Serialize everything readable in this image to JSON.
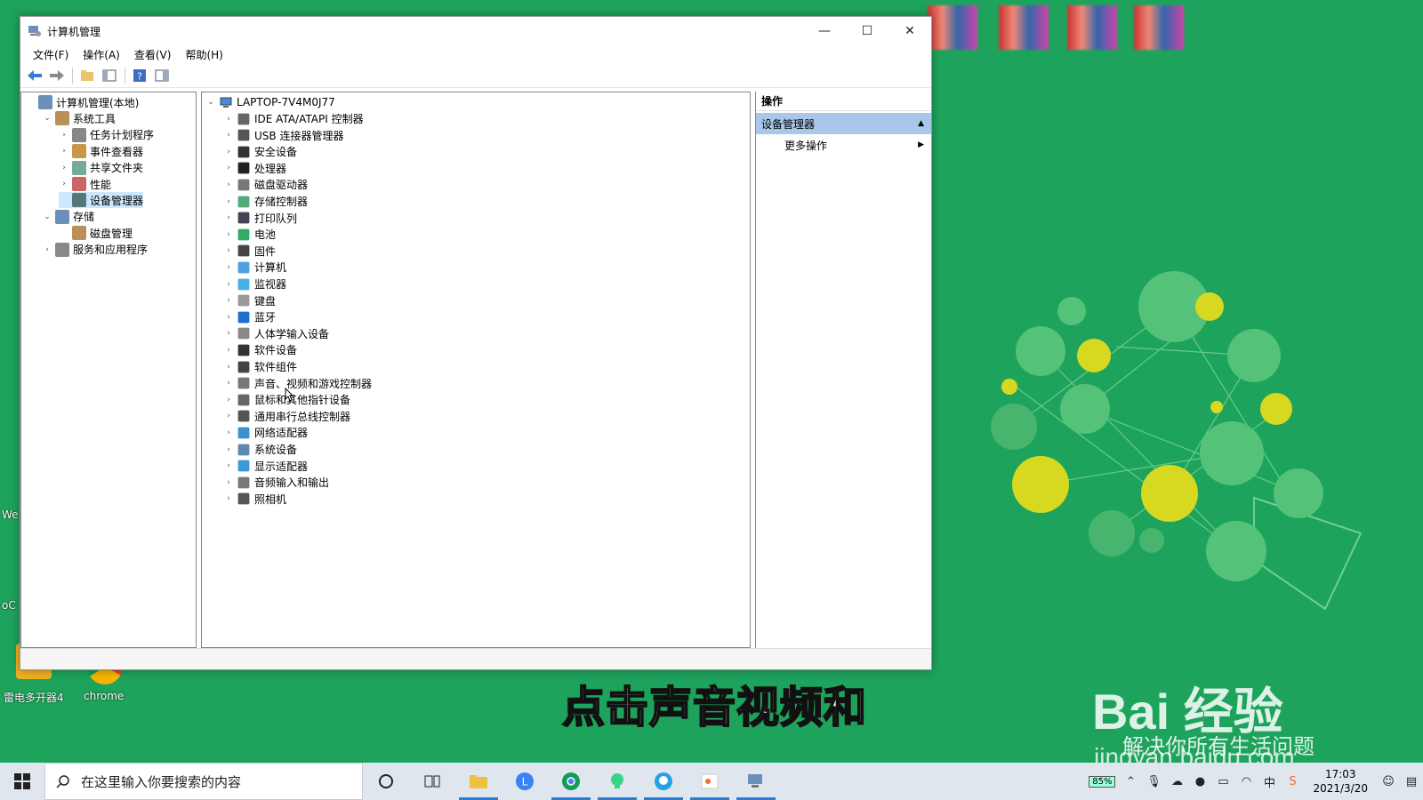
{
  "window": {
    "title": "计算机管理",
    "controls": {
      "minimize": "—",
      "maximize": "☐",
      "close": "✕"
    }
  },
  "menu": [
    "文件(F)",
    "操作(A)",
    "查看(V)",
    "帮助(H)"
  ],
  "left_tree": [
    {
      "label": "计算机管理(本地)",
      "level": 0,
      "arrow": "",
      "icon": "computer-management-icon",
      "selected": false
    },
    {
      "label": "系统工具",
      "level": 1,
      "arrow": "⌄",
      "icon": "system-tools-icon",
      "selected": false
    },
    {
      "label": "任务计划程序",
      "level": 2,
      "arrow": "›",
      "icon": "clock-icon",
      "selected": false
    },
    {
      "label": "事件查看器",
      "level": 2,
      "arrow": "›",
      "icon": "event-viewer-icon",
      "selected": false
    },
    {
      "label": "共享文件夹",
      "level": 2,
      "arrow": "›",
      "icon": "shared-folder-icon",
      "selected": false
    },
    {
      "label": "性能",
      "level": 2,
      "arrow": "›",
      "icon": "performance-icon",
      "selected": false
    },
    {
      "label": "设备管理器",
      "level": 2,
      "arrow": "",
      "icon": "device-manager-icon",
      "selected": true
    },
    {
      "label": "存储",
      "level": 1,
      "arrow": "⌄",
      "icon": "storage-icon",
      "selected": false
    },
    {
      "label": "磁盘管理",
      "level": 2,
      "arrow": "",
      "icon": "disk-management-icon",
      "selected": false
    },
    {
      "label": "服务和应用程序",
      "level": 1,
      "arrow": "›",
      "icon": "services-icon",
      "selected": false
    }
  ],
  "device_tree": {
    "root": "LAPTOP-7V4M0J77",
    "items": [
      {
        "label": "IDE ATA/ATAPI 控制器",
        "icon": "ide-controller-icon"
      },
      {
        "label": "USB 连接器管理器",
        "icon": "usb-icon"
      },
      {
        "label": "安全设备",
        "icon": "security-device-icon"
      },
      {
        "label": "处理器",
        "icon": "processor-icon"
      },
      {
        "label": "磁盘驱动器",
        "icon": "disk-drive-icon"
      },
      {
        "label": "存储控制器",
        "icon": "storage-controller-icon"
      },
      {
        "label": "打印队列",
        "icon": "printer-icon"
      },
      {
        "label": "电池",
        "icon": "battery-icon"
      },
      {
        "label": "固件",
        "icon": "firmware-icon"
      },
      {
        "label": "计算机",
        "icon": "computer-icon"
      },
      {
        "label": "监视器",
        "icon": "monitor-icon"
      },
      {
        "label": "键盘",
        "icon": "keyboard-icon"
      },
      {
        "label": "蓝牙",
        "icon": "bluetooth-icon"
      },
      {
        "label": "人体学输入设备",
        "icon": "hid-icon"
      },
      {
        "label": "软件设备",
        "icon": "software-device-icon"
      },
      {
        "label": "软件组件",
        "icon": "software-component-icon"
      },
      {
        "label": "声音、视频和游戏控制器",
        "icon": "sound-icon"
      },
      {
        "label": "鼠标和其他指针设备",
        "icon": "mouse-icon"
      },
      {
        "label": "通用串行总线控制器",
        "icon": "usb-controller-icon"
      },
      {
        "label": "网络适配器",
        "icon": "network-adapter-icon"
      },
      {
        "label": "系统设备",
        "icon": "system-device-icon"
      },
      {
        "label": "显示适配器",
        "icon": "display-adapter-icon"
      },
      {
        "label": "音频输入和输出",
        "icon": "audio-io-icon"
      },
      {
        "label": "照相机",
        "icon": "camera-icon"
      }
    ]
  },
  "actions": {
    "header": "操作",
    "section": "设备管理器",
    "more": "更多操作"
  },
  "desktop": {
    "icons": [
      "雷电多开器4",
      "chrome",
      "We",
      "oC"
    ]
  },
  "subtitle": "点击声音视频和",
  "watermark": {
    "logo": "Bai 经验",
    "slogan": "解决你所有生活问题",
    "url": "jingyan.baidu.com"
  },
  "taskbar": {
    "search_placeholder": "在这里输入你要搜索的内容",
    "battery": "85%",
    "time": "17:03",
    "date": "2021/3/20",
    "ime": "中"
  },
  "colors": {
    "desktop": "#1ea35c",
    "selection": "#cce8ff",
    "action_section": "#a9c7ea",
    "taskbar": "#dfe6ee"
  }
}
